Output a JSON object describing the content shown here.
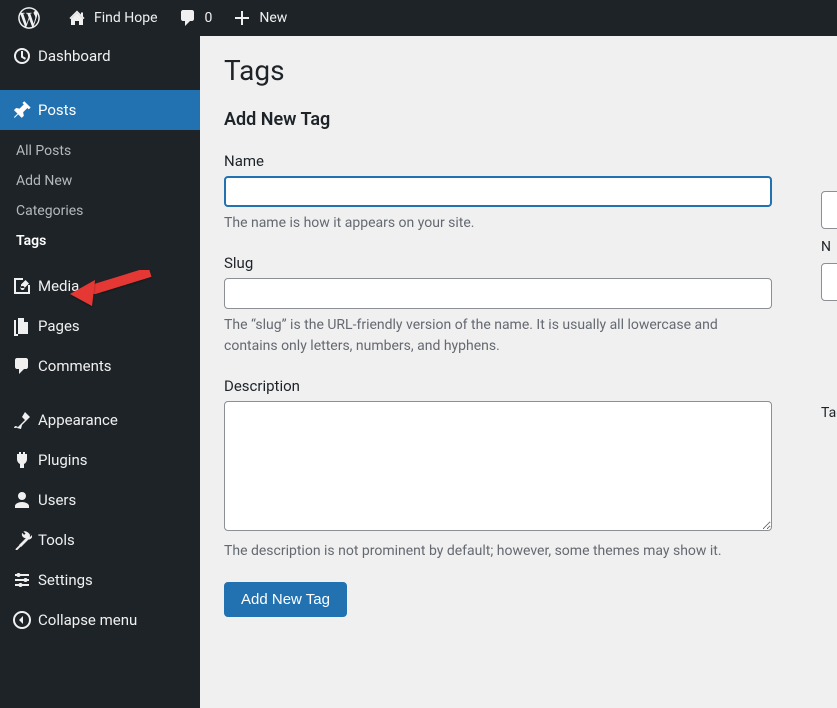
{
  "topbar": {
    "site_name": "Find Hope",
    "comments_count": "0",
    "new_label": "New"
  },
  "sidebar": {
    "dashboard": "Dashboard",
    "posts": "Posts",
    "posts_sub": {
      "all": "All Posts",
      "add": "Add New",
      "categories": "Categories",
      "tags": "Tags"
    },
    "media": "Media",
    "pages": "Pages",
    "comments": "Comments",
    "appearance": "Appearance",
    "plugins": "Plugins",
    "users": "Users",
    "tools": "Tools",
    "settings": "Settings",
    "collapse": "Collapse menu"
  },
  "page": {
    "title": "Tags",
    "subhead": "Add New Tag",
    "name_label": "Name",
    "name_help": "The name is how it appears on your site.",
    "slug_label": "Slug",
    "slug_help": "The “slug” is the URL-friendly version of the name. It is usually all lowercase and contains only letters, numbers, and hyphens.",
    "desc_label": "Description",
    "desc_help": "The description is not prominent by default; however, some themes may show it.",
    "submit": "Add New Tag"
  },
  "rightcol": {
    "n": "N",
    "tag": "Tag"
  }
}
